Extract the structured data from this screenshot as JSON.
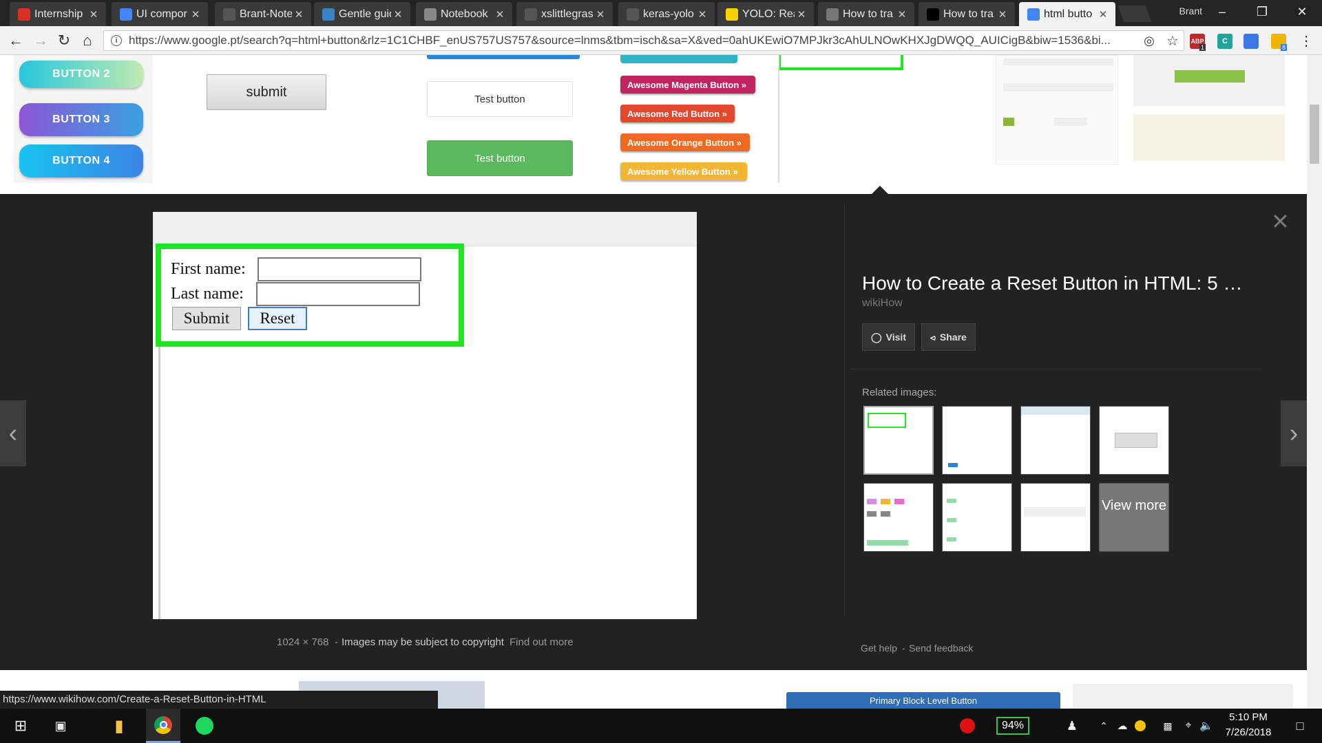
{
  "browser": {
    "tabs": [
      {
        "title": "Internship",
        "icon": "gmail-icon",
        "color": "#d93025"
      },
      {
        "title": "UI compor",
        "icon": "docs-icon",
        "color": "#4285f4"
      },
      {
        "title": "Brant-Note",
        "icon": "github-icon",
        "color": "#555555"
      },
      {
        "title": "Gentle guid",
        "icon": "steam-icon",
        "color": "#3b82c4"
      },
      {
        "title": "Notebook",
        "icon": "page-icon",
        "color": "#888888"
      },
      {
        "title": "xslittlegras",
        "icon": "github-icon",
        "color": "#555555"
      },
      {
        "title": "keras-yolo",
        "icon": "github-icon",
        "color": "#555555"
      },
      {
        "title": "YOLO: Real",
        "icon": "pj-icon",
        "color": "#f6d200"
      },
      {
        "title": "How to tra",
        "icon": "blank-icon",
        "color": "#777777"
      },
      {
        "title": "How to tra",
        "icon": "medium-icon",
        "color": "#000000"
      },
      {
        "title": "html butto",
        "icon": "google-icon",
        "color": "#4285f4"
      }
    ],
    "profile_name": "Brant",
    "url": "https://www.google.pt/search?q=html+button&rlz=1C1CHBF_enUS757US757&source=lnms&tbm=isch&sa=X&ved=0ahUKEwiO7MPJkr3cAhULNOwKHXJgDWQQ_AUICigB&biw=1536&bi...",
    "ext_abp": "ABP",
    "ext_abp_count": "1",
    "ext_c": "C",
    "ext_badge": "8"
  },
  "results_strip": {
    "pill_buttons": [
      "BUTTON 2",
      "BUTTON 3",
      "BUTTON 4"
    ],
    "submit_label": "submit",
    "test_button_1": "Test button",
    "test_button_2": "Test button",
    "awesome_buttons": [
      {
        "label": "Awesome Magenta Button »",
        "color": "#c1245e"
      },
      {
        "label": "Awesome Red Button »",
        "color": "#e3482f"
      },
      {
        "label": "Awesome Orange Button »",
        "color": "#ee6a21"
      },
      {
        "label": "Awesome Yellow Button »",
        "color": "#f2b634"
      }
    ]
  },
  "preview": {
    "first_name_label": "First name:",
    "last_name_label": "Last name:",
    "submit_label": "Submit",
    "reset_label": "Reset",
    "highlight_color": "#1fe61f"
  },
  "image_info": {
    "dimensions": "1024 × 768",
    "copyright": "Images may be subject to copyright",
    "find_out_more": "Find out more"
  },
  "panel": {
    "title": "How to Create a Reset Button in HTML: 5 …",
    "source": "wikiHow",
    "visit_label": "Visit",
    "share_label": "Share",
    "related_label": "Related images:",
    "view_more_label": "View more",
    "get_help": "Get help",
    "separator": "-",
    "send_feedback": "Send feedback"
  },
  "bottom": {
    "status_url": "https://www.wikihow.com/Create-a-Reset-Button-in-HTML",
    "primary_block_label": "Primary Block Level Button"
  },
  "taskbar": {
    "battery": "94%",
    "time": "5:10 PM",
    "date": "7/26/2018"
  }
}
